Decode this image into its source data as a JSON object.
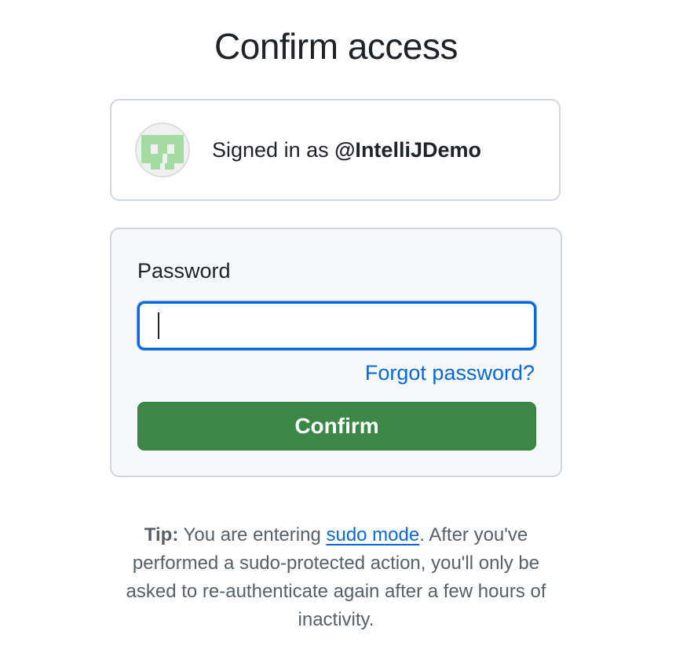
{
  "page": {
    "title": "Confirm access"
  },
  "account": {
    "signed_in_prefix": "Signed in as ",
    "username": "@IntelliJDemo",
    "avatar_icon": "identicon-avatar",
    "avatar_color": "#9fdc9c"
  },
  "form": {
    "password_label": "Password",
    "password_value": "",
    "forgot_link": "Forgot password?",
    "confirm_button": "Confirm",
    "accent_color": "#0969da",
    "button_color": "#3b8745"
  },
  "tip": {
    "label": "Tip:",
    "text_before_link": " You are entering ",
    "link": "sudo mode",
    "text_after_link": ". After you've performed a sudo-protected action, you'll only be asked to re-authenticate again after a few hours of inactivity."
  }
}
